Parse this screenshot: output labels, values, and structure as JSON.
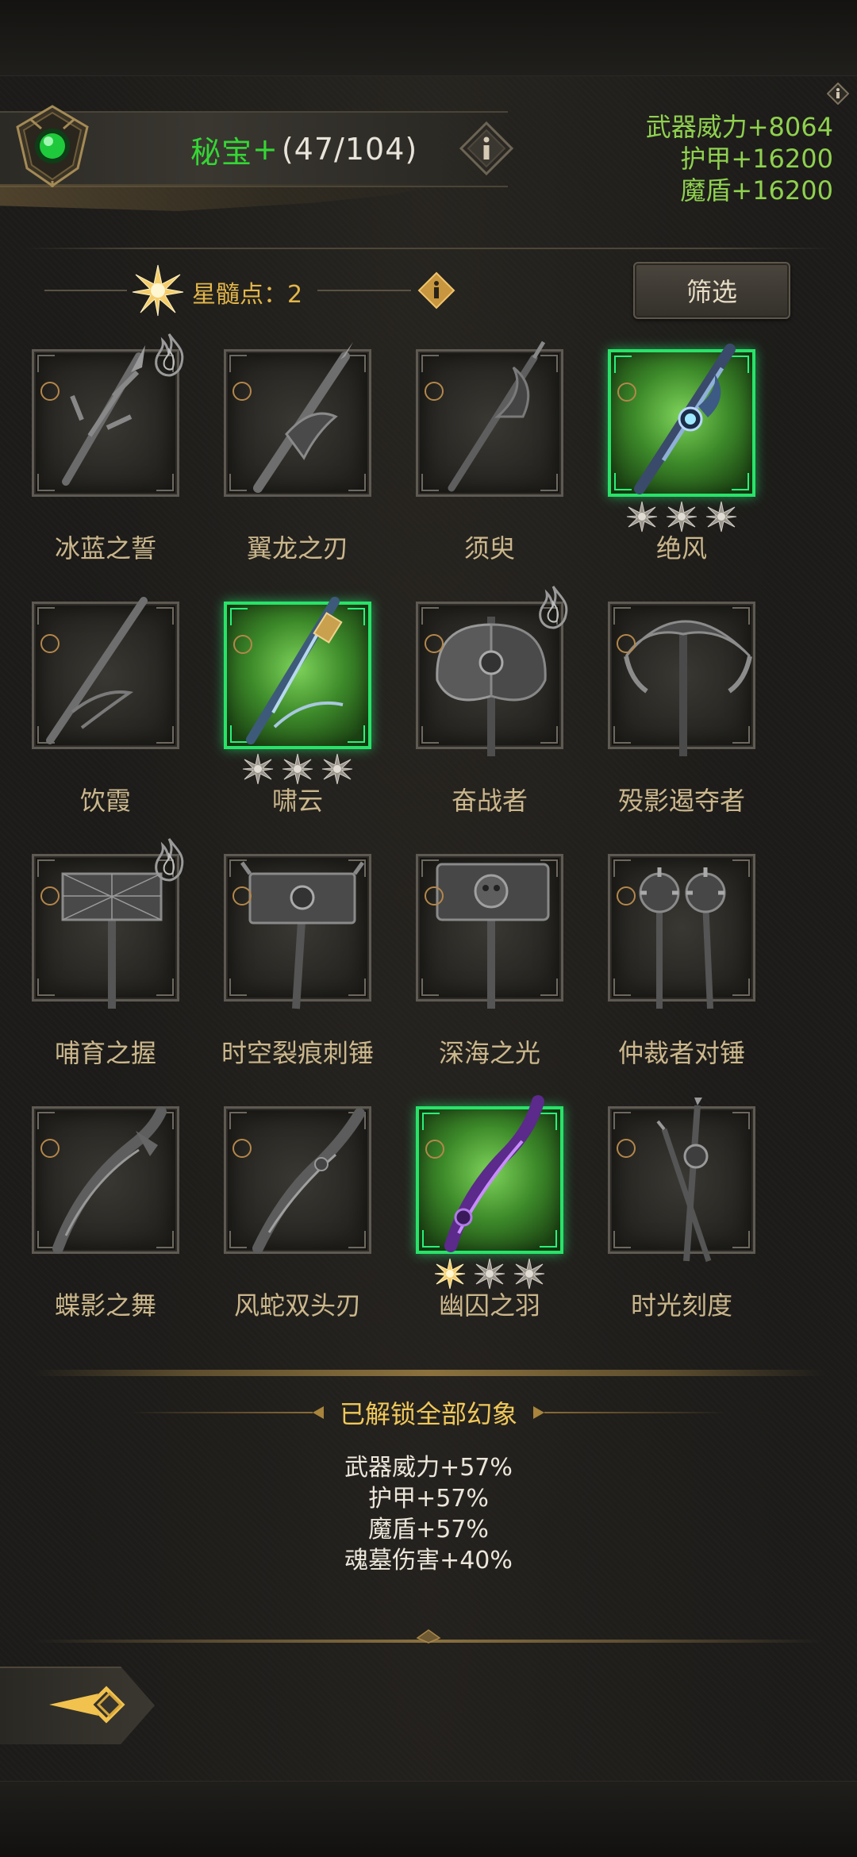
{
  "header": {
    "title_name": "秘宝",
    "title_plus": "+",
    "title_count": "(47/104)"
  },
  "stats": [
    "武器威力+8064",
    "护甲+16200",
    "魔盾+16200"
  ],
  "star_points": {
    "label": "星髓点：2"
  },
  "filter_button": "筛选",
  "items": [
    {
      "name": "冰蓝之誓",
      "unlocked": false,
      "stars": 0,
      "gold_stars": 0,
      "flame": true,
      "weapon": "spiked-sword"
    },
    {
      "name": "翼龙之刃",
      "unlocked": false,
      "stars": 0,
      "gold_stars": 0,
      "flame": false,
      "weapon": "dragon-sword"
    },
    {
      "name": "须臾",
      "unlocked": false,
      "stars": 0,
      "gold_stars": 0,
      "flame": false,
      "weapon": "serpent-sword"
    },
    {
      "name": "绝风",
      "unlocked": true,
      "stars": 3,
      "gold_stars": 0,
      "flame": false,
      "weapon": "ice-sword"
    },
    {
      "name": "饮霞",
      "unlocked": false,
      "stars": 0,
      "gold_stars": 0,
      "flame": false,
      "weapon": "long-blade"
    },
    {
      "name": "啸云",
      "unlocked": true,
      "stars": 3,
      "gold_stars": 0,
      "flame": false,
      "weapon": "storm-blade"
    },
    {
      "name": "奋战者",
      "unlocked": false,
      "stars": 0,
      "gold_stars": 0,
      "flame": true,
      "weapon": "battle-axe"
    },
    {
      "name": "殁影遏夺者",
      "unlocked": false,
      "stars": 0,
      "gold_stars": 0,
      "flame": false,
      "weapon": "crescent-axe"
    },
    {
      "name": "哺育之握",
      "unlocked": false,
      "stars": 0,
      "gold_stars": 0,
      "flame": true,
      "weapon": "web-hammer"
    },
    {
      "name": "时空裂痕刺锤",
      "unlocked": false,
      "stars": 0,
      "gold_stars": 0,
      "flame": false,
      "weapon": "rift-hammer"
    },
    {
      "name": "深海之光",
      "unlocked": false,
      "stars": 0,
      "gold_stars": 0,
      "flame": false,
      "weapon": "skull-hammer"
    },
    {
      "name": "仲裁者对锤",
      "unlocked": false,
      "stars": 0,
      "gold_stars": 0,
      "flame": false,
      "weapon": "twin-maces"
    },
    {
      "name": "蝶影之舞",
      "unlocked": false,
      "stars": 0,
      "gold_stars": 0,
      "flame": false,
      "weapon": "curved-dagger"
    },
    {
      "name": "风蛇双头刃",
      "unlocked": false,
      "stars": 0,
      "gold_stars": 0,
      "flame": false,
      "weapon": "serpent-dagger"
    },
    {
      "name": "幽囚之羽",
      "unlocked": true,
      "stars": 3,
      "gold_stars": 1,
      "flame": false,
      "weapon": "void-dagger"
    },
    {
      "name": "时光刻度",
      "unlocked": false,
      "stars": 0,
      "gold_stars": 0,
      "flame": false,
      "weapon": "twin-daggers"
    }
  ],
  "unlock_section": {
    "title": "已解锁全部幻象",
    "bonuses": [
      "武器威力+57%",
      "护甲+57%",
      "魔盾+57%",
      "魂墓伤害+40%"
    ]
  },
  "colors": {
    "green_title": "#35d635",
    "stat_green": "#8fd14f",
    "gold_text": "#f0c85a",
    "name_text": "#cbb78c",
    "unlock_border": "#28e36a"
  },
  "icons": {
    "emblem": "green-gem-emblem-icon",
    "info": "info-icon",
    "star_point": "star-burst-icon",
    "back": "back-arrow-icon",
    "flame": "flame-badge-icon"
  }
}
